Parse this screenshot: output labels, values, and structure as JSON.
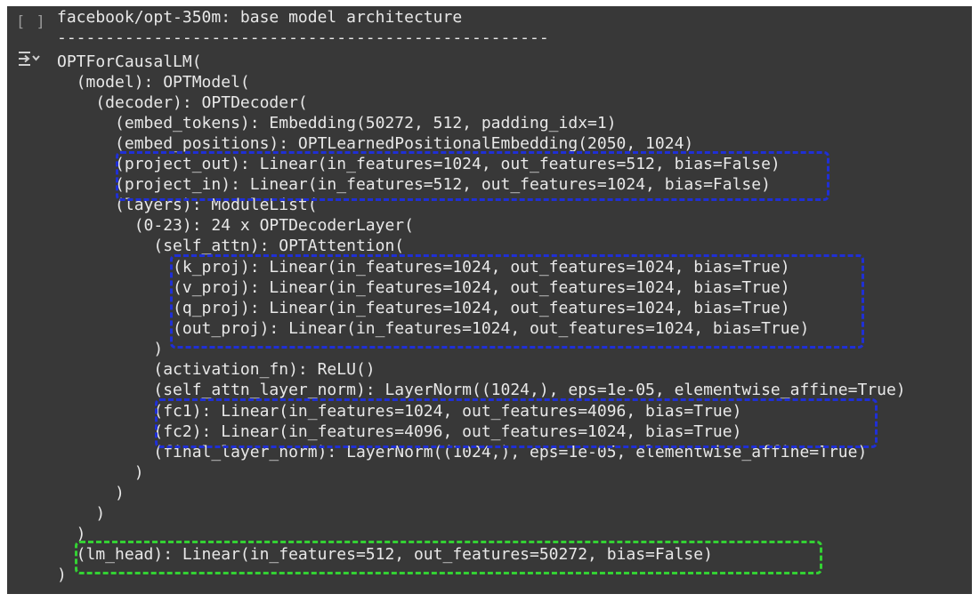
{
  "cell": {
    "run_bracket": "[ ]",
    "output_icon": "output-options-icon",
    "lines": [
      "facebook/opt-350m: base model architecture",
      "---------------------------------------------------",
      "OPTForCausalLM(",
      "  (model): OPTModel(",
      "    (decoder): OPTDecoder(",
      "      (embed_tokens): Embedding(50272, 512, padding_idx=1)",
      "      (embed_positions): OPTLearnedPositionalEmbedding(2050, 1024)",
      "      (project_out): Linear(in_features=1024, out_features=512, bias=False)",
      "      (project_in): Linear(in_features=512, out_features=1024, bias=False)",
      "      (layers): ModuleList(",
      "        (0-23): 24 x OPTDecoderLayer(",
      "          (self_attn): OPTAttention(",
      "            (k_proj): Linear(in_features=1024, out_features=1024, bias=True)",
      "            (v_proj): Linear(in_features=1024, out_features=1024, bias=True)",
      "            (q_proj): Linear(in_features=1024, out_features=1024, bias=True)",
      "            (out_proj): Linear(in_features=1024, out_features=1024, bias=True)",
      "          )",
      "          (activation_fn): ReLU()",
      "          (self_attn_layer_norm): LayerNorm((1024,), eps=1e-05, elementwise_affine=True)",
      "          (fc1): Linear(in_features=1024, out_features=4096, bias=True)",
      "          (fc2): Linear(in_features=4096, out_features=1024, bias=True)",
      "          (final_layer_norm): LayerNorm((1024,), eps=1e-05, elementwise_affine=True)",
      "        )",
      "      )",
      "    )",
      "  )",
      "  (lm_head): Linear(in_features=512, out_features=50272, bias=False)",
      ")"
    ]
  },
  "colors": {
    "cell_background": "#383838",
    "text": "#e8e8e8",
    "highlight_blue": "#1f2fd6",
    "highlight_green": "#33d133"
  }
}
